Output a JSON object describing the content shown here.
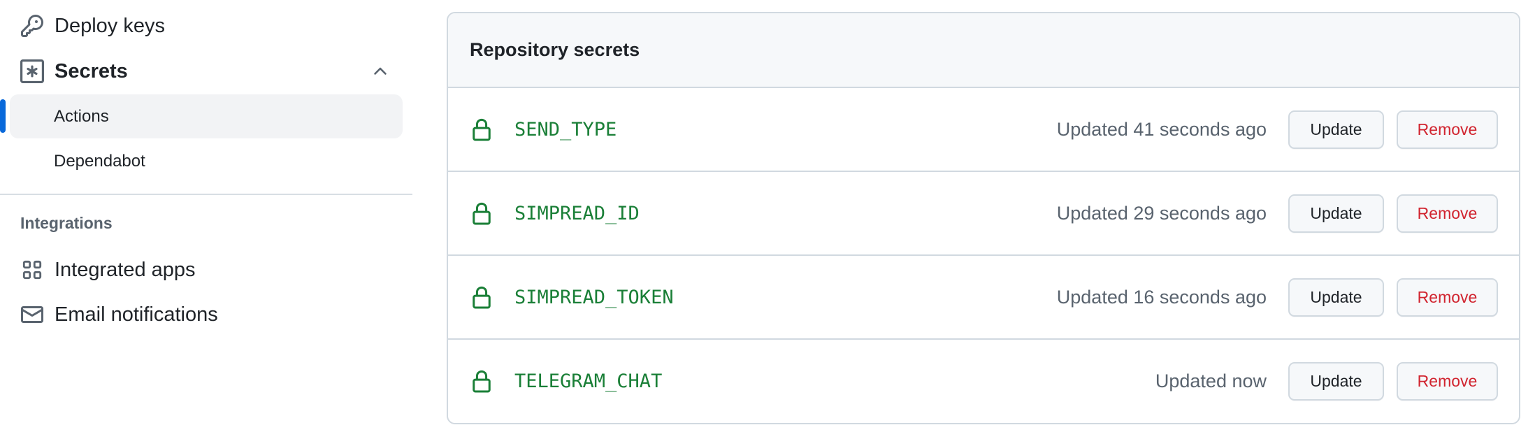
{
  "sidebar": {
    "deploy_keys": "Deploy keys",
    "secrets": {
      "label": "Secrets",
      "expanded": true,
      "items": [
        {
          "label": "Actions",
          "active": true
        },
        {
          "label": "Dependabot",
          "active": false
        }
      ]
    },
    "integrations_heading": "Integrations",
    "integrated_apps": "Integrated apps",
    "email_notifications": "Email notifications"
  },
  "panel": {
    "title": "Repository secrets",
    "update_label": "Update",
    "remove_label": "Remove",
    "secrets": [
      {
        "name": "SEND_TYPE",
        "updated": "Updated 41 seconds ago"
      },
      {
        "name": "SIMPREAD_ID",
        "updated": "Updated 29 seconds ago"
      },
      {
        "name": "SIMPREAD_TOKEN",
        "updated": "Updated 16 seconds ago"
      },
      {
        "name": "TELEGRAM_CHAT",
        "updated": "Updated now"
      }
    ]
  },
  "colors": {
    "accent": "#0969da",
    "secret_green": "#1a7f37",
    "danger": "#d1242f",
    "muted": "#59636e",
    "border": "#d1d9e0"
  }
}
